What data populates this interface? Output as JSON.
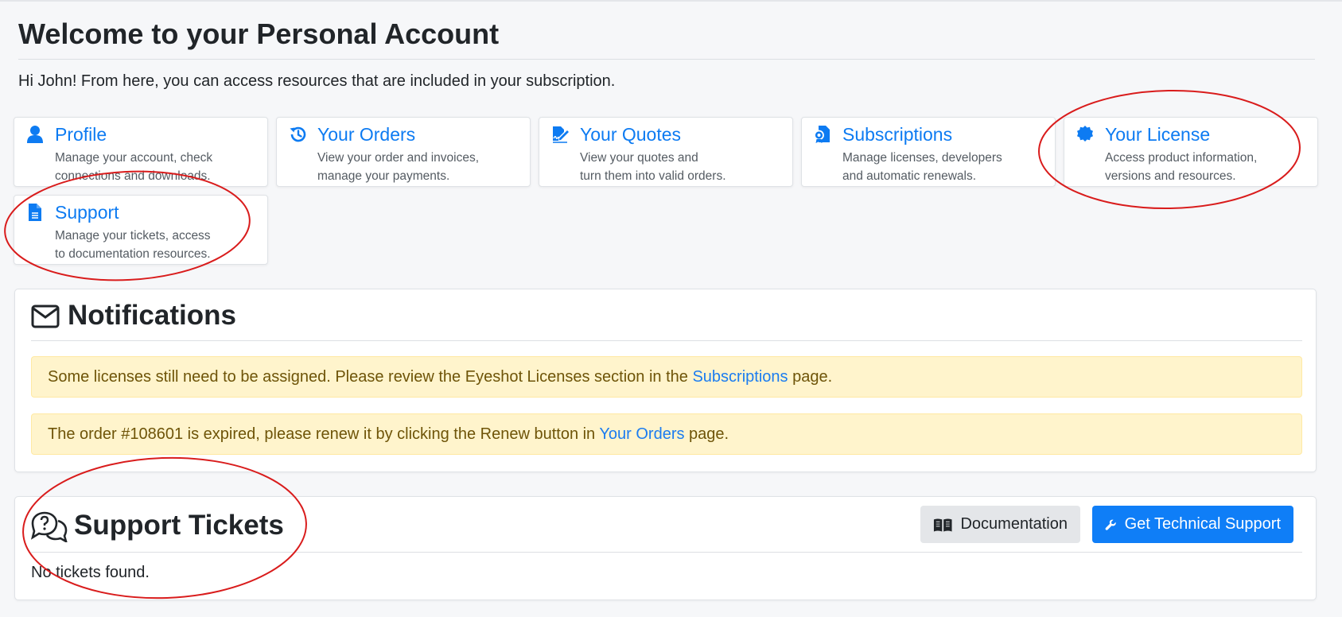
{
  "page": {
    "title": "Welcome to your Personal Account",
    "intro": "Hi John! From here, you can access resources that are included in your subscription."
  },
  "cards": [
    {
      "icon": "user-icon",
      "title": "Profile",
      "desc_line1": "Manage your account, check",
      "desc_line2": "connections and downloads."
    },
    {
      "icon": "history-icon",
      "title": "Your Orders",
      "desc_line1": "View your order and invoices,",
      "desc_line2": "manage your payments."
    },
    {
      "icon": "file-signature-icon",
      "title": "Your Quotes",
      "desc_line1": "View your quotes and",
      "desc_line2": "turn them into valid orders."
    },
    {
      "icon": "file-contract-icon",
      "title": "Subscriptions",
      "desc_line1": "Manage licenses, developers",
      "desc_line2": "and automatic renewals."
    },
    {
      "icon": "certificate-icon",
      "title": "Your License",
      "desc_line1": "Access product information,",
      "desc_line2": "versions and resources."
    },
    {
      "icon": "file-alt-icon",
      "title": "Support",
      "desc_line1": "Manage your tickets, access",
      "desc_line2": "to documentation resources."
    }
  ],
  "notifications": {
    "title": "Notifications",
    "alerts": [
      {
        "text_before": "Some licenses still need to be assigned. Please review the Eyeshot Licenses section in the ",
        "link": "Subscriptions",
        "text_after": " page."
      },
      {
        "text_before": "The order #108601 is expired, please renew it by clicking the Renew button in ",
        "link": "Your Orders",
        "text_after": " page."
      }
    ]
  },
  "tickets": {
    "title": "Support Tickets",
    "documentation_label": "Documentation",
    "support_label": "Get Technical Support",
    "empty_text": "No tickets found."
  },
  "colors": {
    "link": "#0d7bf2",
    "primary_button": "#0f7ef7",
    "alert_bg": "#fff4cc",
    "annotation": "#d91c1c"
  }
}
